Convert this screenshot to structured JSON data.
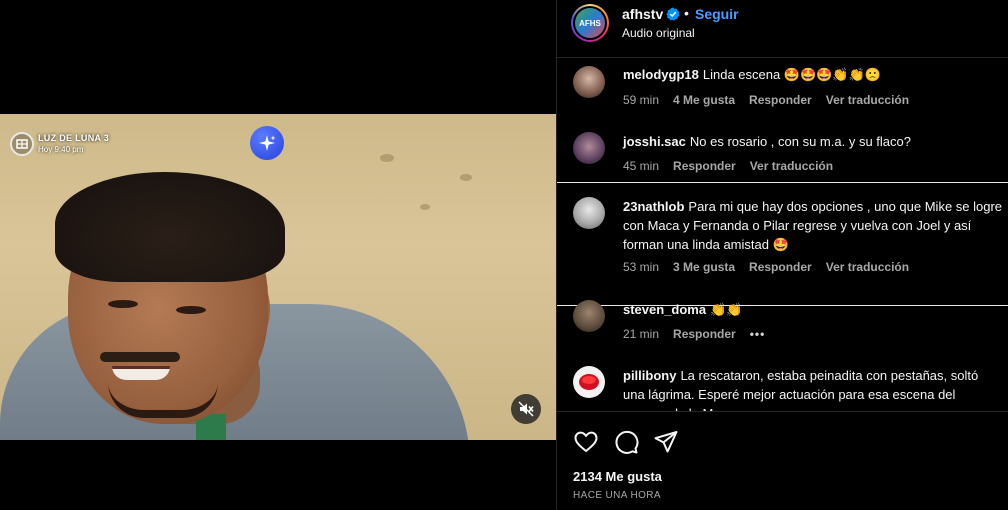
{
  "video": {
    "channel_name": "LUZ DE LUNA 3",
    "channel_time": "Hoy 9:40 pm",
    "ai_icon": "sparkle-icon",
    "mute_icon": "muted-speaker-icon"
  },
  "post": {
    "username": "afhstv",
    "separator": "•",
    "follow_label": "Seguir",
    "audio": "Audio original",
    "avatar_text": "AFHS",
    "verified_color": "#0095f6"
  },
  "comments": [
    {
      "user": "melodygp18",
      "text": "Linda escena 🤩🤩🤩👏👏🙁",
      "time": "59 min",
      "likes": "4 Me gusta",
      "reply": "Responder",
      "translate": "Ver traducción"
    },
    {
      "user": "josshi.sac",
      "text": "No es rosario , con su m.a. y su flaco?",
      "time": "45 min",
      "reply": "Responder",
      "translate": "Ver traducción"
    },
    {
      "user": "23nathlob",
      "text": "Para mi que hay dos opciones , uno que Mike se logre con Maca y Fernanda o Pilar regrese y vuelva con Joel y así forman una linda amistad 🤩",
      "time": "53 min",
      "likes": "3 Me gusta",
      "reply": "Responder",
      "translate": "Ver traducción"
    },
    {
      "user": "steven_doma",
      "text": "👏👏",
      "time": "21 min",
      "reply": "Responder",
      "more": "•••"
    },
    {
      "user": "pillibony",
      "text": "La rescataron, estaba peinadita con pestañas, soltó una lágrima. Esperé mejor actuación para esa escena del regreso de la M",
      "time": "",
      "reply": ""
    }
  ],
  "footer": {
    "likes": "2134 Me gusta",
    "posted": "HACE UNA HORA",
    "icons": [
      "heart-icon",
      "comment-icon",
      "share-icon"
    ]
  },
  "colors": {
    "background": "#000000",
    "link_blue": "#4a9eff",
    "muted_text": "#a8a8a8",
    "divider": "#262626"
  }
}
